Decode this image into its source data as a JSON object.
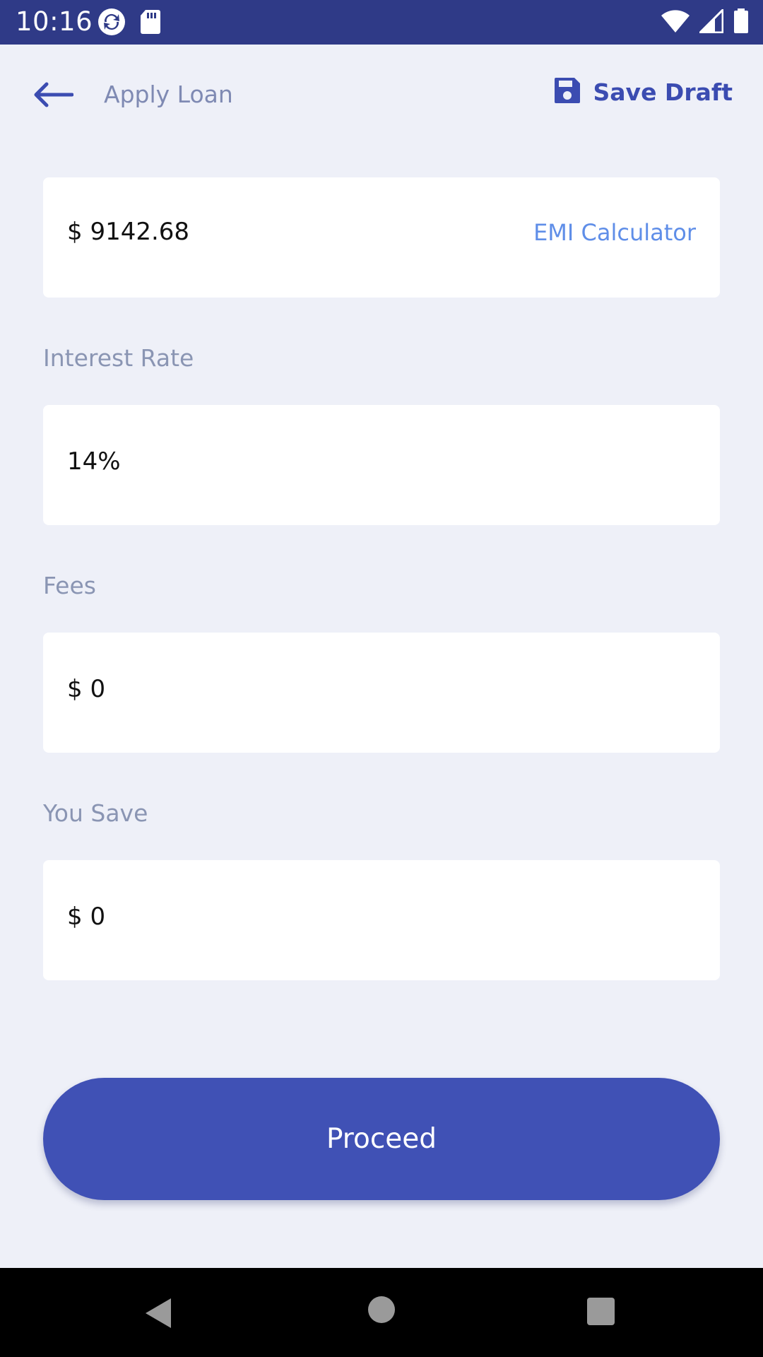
{
  "status_bar": {
    "time": "10:16",
    "icons": [
      "sync-icon",
      "sd-card-icon",
      "wifi-icon",
      "cellular-signal-icon",
      "battery-icon"
    ]
  },
  "app_bar": {
    "title": "Apply Loan",
    "back_icon": "arrow-left-icon",
    "save_draft_label": "Save Draft",
    "save_draft_icon": "save-icon"
  },
  "form": {
    "amount": {
      "value": "$ 9142.68",
      "link_label": "EMI Calculator"
    },
    "interest_rate": {
      "label": "Interest Rate",
      "value": "14%"
    },
    "fees": {
      "label": "Fees",
      "value": "$ 0"
    },
    "you_save": {
      "label": "You Save",
      "value": "$ 0"
    }
  },
  "actions": {
    "proceed_label": "Proceed"
  },
  "nav_bar": {
    "icons": [
      "back-triangle-icon",
      "home-circle-icon",
      "recents-square-icon"
    ]
  },
  "colors": {
    "status_bar": "#2f3a87",
    "background": "#eef0f8",
    "accent": "#3b4cb1",
    "button": "#4051b5",
    "link": "#5f8ee8",
    "label": "#8a95b3"
  }
}
